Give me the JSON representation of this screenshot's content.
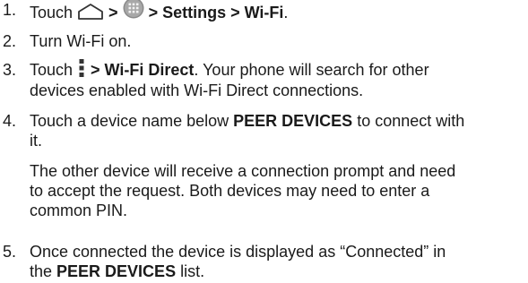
{
  "steps": [
    {
      "number": "1.",
      "sep1": " > ",
      "sep2": " > ",
      "path": "Settings > Wi-Fi",
      "period": ".",
      "icons": [
        "home-icon",
        "apps-icon"
      ],
      "label_prefix": "Touch "
    },
    {
      "number": "2.",
      "text": "Turn Wi-Fi on."
    },
    {
      "number": "3.",
      "label_prefix": "Touch ",
      "target": " > Wi-Fi Direct",
      "rest_line1": ". Your phone will search for other",
      "line2": "devices enabled with Wi-Fi Direct connections.",
      "icons": [
        "menu-icon"
      ]
    },
    {
      "number": "4.",
      "label_prefix": "Touch a device name below ",
      "target": "PEER DEVICES",
      "rest_line1": " to connect with",
      "line2": "it.",
      "note_line1": "The other device will receive a connection prompt and need",
      "note_line2": "to accept the request. Both devices may need to enter a",
      "note_line3": "common PIN."
    },
    {
      "number": "5.",
      "line1": "Once connected the device is displayed as “Connected” in",
      "line2_prefix": "the ",
      "target": "PEER DEVICES",
      "line2_suffix": " list."
    }
  ]
}
